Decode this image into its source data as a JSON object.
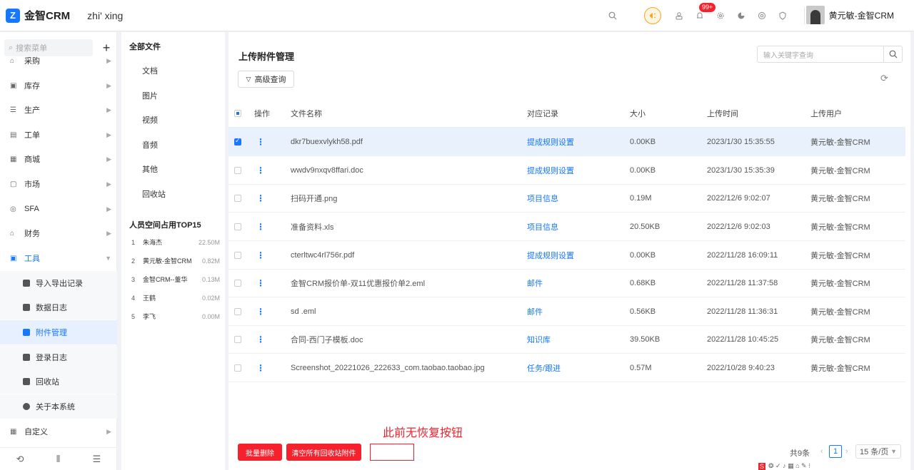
{
  "app": {
    "logo_glyph": "Z",
    "name": "金智CRM",
    "tenant": "zhi' xing"
  },
  "header": {
    "icons": [
      "search-icon",
      "megaphone-icon",
      "contacts-icon",
      "bell-icon",
      "settings-icon",
      "pie-chart-icon",
      "chrome-icon",
      "shield-icon"
    ],
    "notification_badge": "99+",
    "user_name": "黄元敏-金智CRM"
  },
  "sidebar": {
    "search_placeholder": "搜索菜单",
    "add": "+",
    "items": [
      {
        "label": "采购",
        "icon": "⌂"
      },
      {
        "label": "库存",
        "icon": "▣"
      },
      {
        "label": "生产",
        "icon": "☰"
      },
      {
        "label": "工单",
        "icon": "▤"
      },
      {
        "label": "商城",
        "icon": "▦"
      },
      {
        "label": "市场",
        "icon": "▢"
      },
      {
        "label": "SFA",
        "icon": "◎"
      },
      {
        "label": "财务",
        "icon": "⌂"
      },
      {
        "label": "工具",
        "icon": "▣"
      },
      {
        "label": "自定义",
        "icon": "▦"
      }
    ],
    "tools_sub": [
      "导入导出记录",
      "数据日志",
      "附件管理",
      "登录日志",
      "回收站",
      "关于本系统"
    ],
    "bottom_icons": [
      "history-icon",
      "sliders-icon",
      "collapse-icon"
    ]
  },
  "file_tree": {
    "title": "全部文件",
    "items": [
      "文档",
      "图片",
      "视频",
      "音频",
      "其他",
      "回收站"
    ],
    "top15_title": "人员空间占用TOP15",
    "top15": [
      {
        "n": "1",
        "name": "朱海杰",
        "size": "22.50M"
      },
      {
        "n": "2",
        "name": "黄元敏-金智CRM",
        "size": "0.82M"
      },
      {
        "n": "3",
        "name": "金智CRM--董华",
        "size": "0.13M"
      },
      {
        "n": "4",
        "name": "王鹤",
        "size": "0.02M"
      },
      {
        "n": "5",
        "name": "李飞",
        "size": "0.00M"
      }
    ]
  },
  "main": {
    "title": "上传附件管理",
    "keyword_placeholder": "输入关键字查询",
    "advanced_query": "高级查询",
    "columns": {
      "op": "操作",
      "name": "文件名称",
      "record": "对应记录",
      "size": "大小",
      "time": "上传时间",
      "user": "上传用户"
    },
    "rows": [
      {
        "name": "dkr7buexvlykh58.pdf",
        "record": "提成规则设置",
        "size": "0.00KB",
        "time": "2023/1/30 15:35:55",
        "user": "黄元敏-金智CRM"
      },
      {
        "name": "wwdv9nxqv8ffari.doc",
        "record": "提成规则设置",
        "size": "0.00KB",
        "time": "2023/1/30 15:35:39",
        "user": "黄元敏-金智CRM"
      },
      {
        "name": "扫码开通.png",
        "record": "项目信息",
        "size": "0.19M",
        "time": "2022/12/6 9:02:07",
        "user": "黄元敏-金智CRM"
      },
      {
        "name": "准备资料.xls",
        "record": "项目信息",
        "size": "20.50KB",
        "time": "2022/12/6 9:02:03",
        "user": "黄元敏-金智CRM"
      },
      {
        "name": "cterltwc4rl756r.pdf",
        "record": "提成规则设置",
        "size": "0.00KB",
        "time": "2022/11/28 16:09:11",
        "user": "黄元敏-金智CRM"
      },
      {
        "name": "金智CRM报价单-双11优惠报价单2.eml",
        "record": "邮件",
        "size": "0.68KB",
        "time": "2022/11/28 11:37:58",
        "user": "黄元敏-金智CRM"
      },
      {
        "name": "sd .eml",
        "record": "邮件",
        "size": "0.56KB",
        "time": "2022/11/28 11:36:31",
        "user": "黄元敏-金智CRM"
      },
      {
        "name": "合同-西门子模板.doc",
        "record": "知识库",
        "size": "39.50KB",
        "time": "2022/11/28 10:45:25",
        "user": "黄元敏-金智CRM"
      },
      {
        "name": "Screenshot_20221026_222633_com.taobao.taobao.jpg",
        "record": "任务/跟进",
        "size": "0.57M",
        "time": "2022/10/28 9:40:23",
        "user": "黄元敏-金智CRM"
      }
    ],
    "batch_delete": "批量删除",
    "clear_recycle": "清空所有回收站附件",
    "annotation": "此前无恢复按钮",
    "total": "共9条",
    "current_page": "1",
    "page_size": "15 条/页",
    "tray_text": "S"
  },
  "colors": {
    "primary": "#1677ff",
    "danger": "#f5222d",
    "accent": "#f5a623"
  }
}
